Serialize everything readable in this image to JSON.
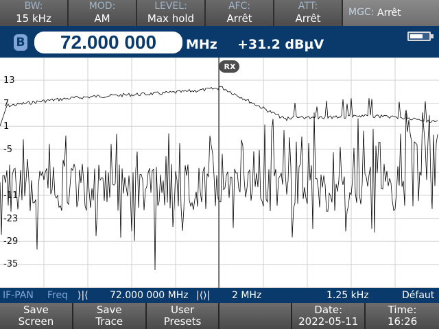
{
  "top_params": [
    {
      "label": "BW:",
      "value": "15 kHz"
    },
    {
      "label": "MOD:",
      "value": "AM"
    },
    {
      "label": "LEVEL:",
      "value": "Max hold"
    },
    {
      "label": "AFC:",
      "value": "Arrêt"
    },
    {
      "label": "ATT:",
      "value": "Arrêt"
    }
  ],
  "mgc": {
    "label": "MGC:",
    "value": "Arrêt"
  },
  "freq": {
    "badge": "B",
    "value": "72.000 000",
    "unit": "MHz",
    "level": "+31.2 dBµV"
  },
  "graph": {
    "marker_label": "RX",
    "y_labels": [
      "13",
      "7",
      "1",
      "-5",
      "-11",
      "-17",
      "-23",
      "-29",
      "-35"
    ]
  },
  "info": {
    "mode": "IF-PAN",
    "freq_label": "Freq",
    "center_icon": "center-marker-icon",
    "center": "72.000 000 MHz",
    "span_icon": "span-marker-icon",
    "span": "2 MHz",
    "step": "1.25 kHz",
    "preset": "Défaut"
  },
  "softkeys": [
    {
      "line1": "Save",
      "line2": "Screen"
    },
    {
      "line1": "Save",
      "line2": "Trace"
    },
    {
      "line1": "User",
      "line2": "Presets"
    },
    {
      "line1": "",
      "line2": ""
    },
    {
      "line1": "Date:",
      "line2": "2022-05-11"
    },
    {
      "line1": "Time:",
      "line2": "16:26"
    }
  ],
  "colors": {
    "header_blue": "#0a3a6c",
    "accent_blue": "#7fa6d6",
    "trace": "#000000"
  }
}
